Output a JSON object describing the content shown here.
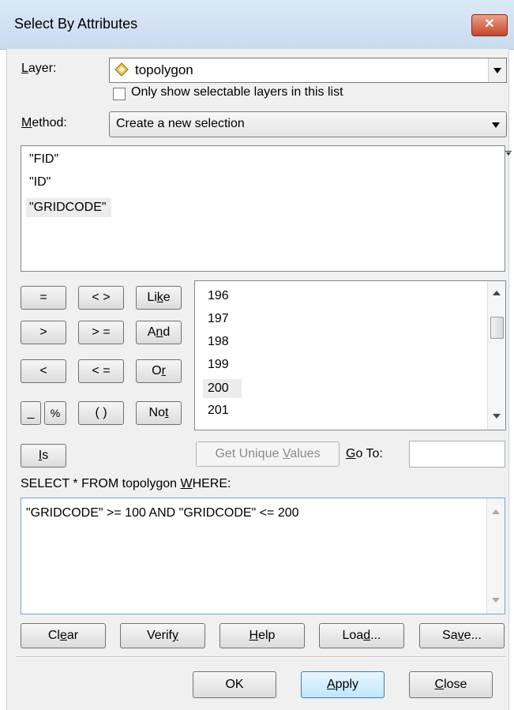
{
  "window": {
    "title": "Select By Attributes",
    "close_glyph": "✕"
  },
  "layer": {
    "label": "Layer:",
    "value": "topolygon",
    "only_selectable": "Only show selectable layers in this list"
  },
  "method": {
    "label": "Method:",
    "value": "Create a new selection"
  },
  "fields": [
    "\"FID\"",
    "\"ID\"",
    "\"GRIDCODE\""
  ],
  "operators": {
    "eq": "=",
    "ne": "< >",
    "like": "Like",
    "gt": ">",
    "ge": "> =",
    "and": "And",
    "lt": "<",
    "le": "< =",
    "or": "Or",
    "underscore": "_",
    "percent": "%",
    "parens": "( )",
    "not": "Not",
    "is": "Is"
  },
  "values": [
    "196",
    "197",
    "198",
    "199",
    "200",
    "201"
  ],
  "unique": {
    "get_button": "Get Unique Values",
    "goto_label": "Go To:",
    "goto_value": ""
  },
  "query": {
    "prefix": "SELECT * FROM topolygon WHERE:",
    "expression": "\"GRIDCODE\" >=  100 AND \"GRIDCODE\" <=  200"
  },
  "actions": {
    "clear": "Clear",
    "verify": "Verify",
    "help": "Help",
    "load": "Load...",
    "save": "Save..."
  },
  "footer": {
    "ok": "OK",
    "apply": "Apply",
    "close": "Close"
  }
}
